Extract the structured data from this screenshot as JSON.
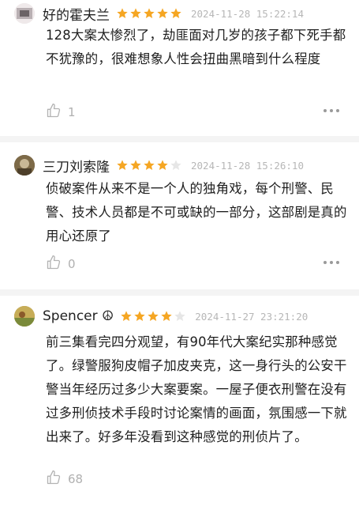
{
  "reviews": [
    {
      "author": "好的霍夫兰",
      "rating": 5,
      "time": "2024-11-28 15:22:14",
      "text": "128大案太惨烈了，劫匪面对几岁的孩子都下死手都不犹豫的，很难想象人性会扭曲黑暗到什么程度",
      "likes": "1"
    },
    {
      "author": "三刀刘索隆",
      "rating": 4,
      "time": "2024-11-28 15:26:10",
      "text": "侦破案件从来不是一个人的独角戏，每个刑警、民警、技术人员都是不可或缺的一部分，这部剧是真的用心还原了",
      "likes": "0"
    },
    {
      "author": "Spencer ☮",
      "rating": 4,
      "time": "2024-11-27 23:21:20",
      "text": "前三集看完四分观望，有90年代大案纪实那种感觉了。绿警服狗皮帽子加皮夹克，这一身行头的公安干警当年经历过多少大案要案。一屋子便衣刑警在没有过多刑侦技术手段时讨论案情的画面，氛围感一下就出来了。好多年没看到这种感觉的刑侦片了。",
      "likes": "68"
    }
  ],
  "colors": {
    "star_on": "#f5a623",
    "star_off": "#e6e6e6",
    "meta": "#b7b7b7"
  }
}
